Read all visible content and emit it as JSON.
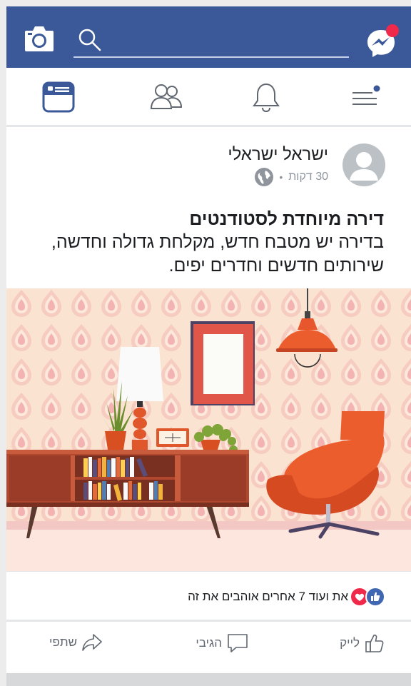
{
  "header": {
    "camera_icon": "camera-icon",
    "search_icon": "search-icon",
    "messenger_icon": "messenger-icon",
    "brand_color": "#3b5998"
  },
  "nav": {
    "items": [
      {
        "name": "news-feed-tab",
        "icon": "news-feed-icon",
        "active": true
      },
      {
        "name": "friends-tab",
        "icon": "friends-icon",
        "active": false
      },
      {
        "name": "notifications-tab",
        "icon": "bell-icon",
        "active": false
      },
      {
        "name": "menu-tab",
        "icon": "hamburger-icon",
        "active": false
      }
    ]
  },
  "post": {
    "author": "ישראל ישראלי",
    "time": "30 דקות",
    "privacy_icon": "globe-icon",
    "title": "דירה מיוחדת לסטודנטים",
    "body": "בדירה יש מטבח חדש, מקלחת גדולה וחדשה, שירותים חדשים וחדרים יפים."
  },
  "reactions": {
    "text": "את ועוד 7 אחרים אוהבים את זה",
    "icons": [
      "like-reaction-icon",
      "love-reaction-icon"
    ]
  },
  "actions": {
    "like": "לייק",
    "comment": "הגיבי",
    "share": "שתפי"
  }
}
